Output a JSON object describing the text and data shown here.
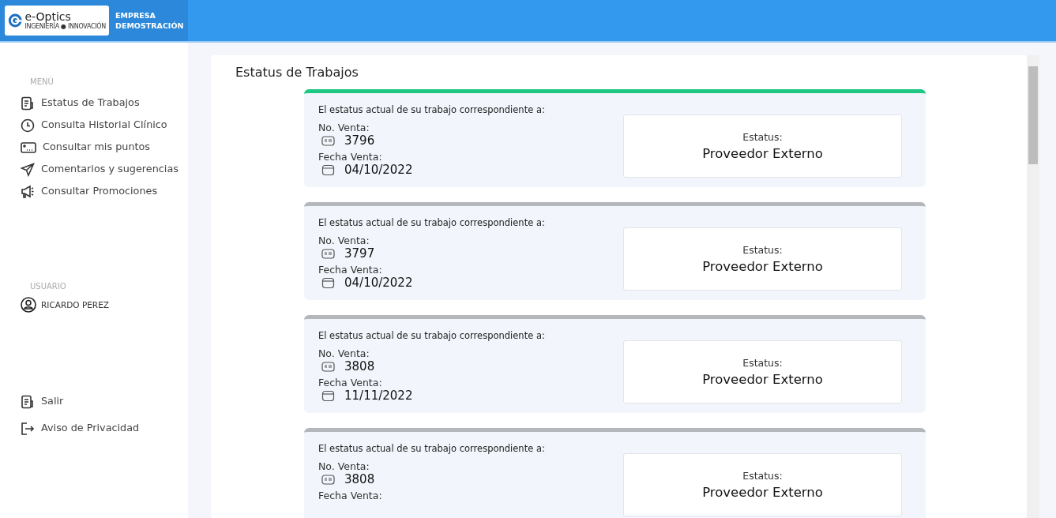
{
  "brand": {
    "logo_text": "e-Optics",
    "logo_tagline": "INGENIERÍA ● INNOVACIÓN",
    "company": "EMPRESA DEMOSTRACIÓN"
  },
  "sidebar": {
    "menu_heading": "MENÚ",
    "items": [
      {
        "label": "Estatus de Trabajos",
        "kind": "document"
      },
      {
        "label": "Consulta Historial Clínico",
        "kind": "clock"
      },
      {
        "label": "Consultar mis puntos",
        "kind": "card"
      },
      {
        "label": "Comentarios y sugerencias",
        "kind": "send"
      },
      {
        "label": "Consultar Promociones",
        "kind": "megaphone"
      }
    ],
    "user_heading": "USUARIO",
    "user_name": "RICARDO PEREZ",
    "footer_items": [
      {
        "label": "Salir",
        "kind": "document"
      },
      {
        "label": "Aviso de Privacidad",
        "kind": "exit"
      }
    ]
  },
  "page_title": "Estatus de Trabajos",
  "jobs": [
    {
      "color": "#1ec882",
      "intro": "El estatus actual de su trabajo correspondiente a:",
      "sale_label": "No. Venta:",
      "sale_number": "3796",
      "date_label": "Fecha Venta:",
      "date": "04/10/2022",
      "status_label": "Estatus:",
      "status": "Proveedor Externo"
    },
    {
      "color": "#b4b8bc",
      "intro": "El estatus actual de su trabajo correspondiente a:",
      "sale_label": "No. Venta:",
      "sale_number": "3797",
      "date_label": "Fecha Venta:",
      "date": "04/10/2022",
      "status_label": "Estatus:",
      "status": "Proveedor Externo"
    },
    {
      "color": "#b4b8bc",
      "intro": "El estatus actual de su trabajo correspondiente a:",
      "sale_label": "No. Venta:",
      "sale_number": "3808",
      "date_label": "Fecha Venta:",
      "date": "11/11/2022",
      "status_label": "Estatus:",
      "status": "Proveedor Externo"
    },
    {
      "color": "#b4b8bc",
      "intro": "El estatus actual de su trabajo correspondiente a:",
      "sale_label": "No. Venta:",
      "sale_number": "3808",
      "date_label": "Fecha Venta:",
      "status_label": "Estatus:",
      "status": "Proveedor Externo"
    }
  ]
}
